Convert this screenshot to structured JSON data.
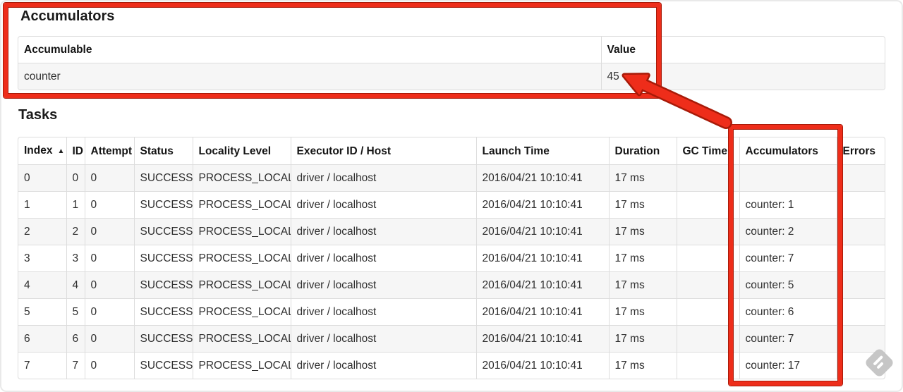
{
  "colors": {
    "annotation_red": "#ee2d1a",
    "annotation_red_dark": "#a81a08",
    "table_border": "#dddddd",
    "row_stripe": "#f6f6f6",
    "resize_icon_gray": "#c6c6c6",
    "heading_text": "#1b1b1b",
    "cell_text": "#2f2f2f"
  },
  "accumulators": {
    "heading": "Accumulators",
    "table": {
      "headers": [
        "Accumulable",
        "Value"
      ],
      "rows": [
        [
          "counter",
          "45"
        ]
      ]
    }
  },
  "tasks": {
    "heading": "Tasks",
    "table": {
      "headers": [
        "Index",
        "ID",
        "Attempt",
        "Status",
        "Locality Level",
        "Executor ID / Host",
        "Launch Time",
        "Duration",
        "GC Time",
        "Accumulators",
        "Errors"
      ],
      "sort_column_index": 0,
      "sort_icon": "▲",
      "rows": [
        [
          "0",
          "0",
          "0",
          "SUCCESS",
          "PROCESS_LOCAL",
          "driver / localhost",
          "2016/04/21 10:10:41",
          "17 ms",
          "",
          "",
          ""
        ],
        [
          "1",
          "1",
          "0",
          "SUCCESS",
          "PROCESS_LOCAL",
          "driver / localhost",
          "2016/04/21 10:10:41",
          "17 ms",
          "",
          "counter: 1",
          ""
        ],
        [
          "2",
          "2",
          "0",
          "SUCCESS",
          "PROCESS_LOCAL",
          "driver / localhost",
          "2016/04/21 10:10:41",
          "17 ms",
          "",
          "counter: 2",
          ""
        ],
        [
          "3",
          "3",
          "0",
          "SUCCESS",
          "PROCESS_LOCAL",
          "driver / localhost",
          "2016/04/21 10:10:41",
          "17 ms",
          "",
          "counter: 7",
          ""
        ],
        [
          "4",
          "4",
          "0",
          "SUCCESS",
          "PROCESS_LOCAL",
          "driver / localhost",
          "2016/04/21 10:10:41",
          "17 ms",
          "",
          "counter: 5",
          ""
        ],
        [
          "5",
          "5",
          "0",
          "SUCCESS",
          "PROCESS_LOCAL",
          "driver / localhost",
          "2016/04/21 10:10:41",
          "17 ms",
          "",
          "counter: 6",
          ""
        ],
        [
          "6",
          "6",
          "0",
          "SUCCESS",
          "PROCESS_LOCAL",
          "driver / localhost",
          "2016/04/21 10:10:41",
          "17 ms",
          "",
          "counter: 7",
          ""
        ],
        [
          "7",
          "7",
          "0",
          "SUCCESS",
          "PROCESS_LOCAL",
          "driver / localhost",
          "2016/04/21 10:10:41",
          "17 ms",
          "",
          "counter: 17",
          ""
        ]
      ]
    }
  }
}
